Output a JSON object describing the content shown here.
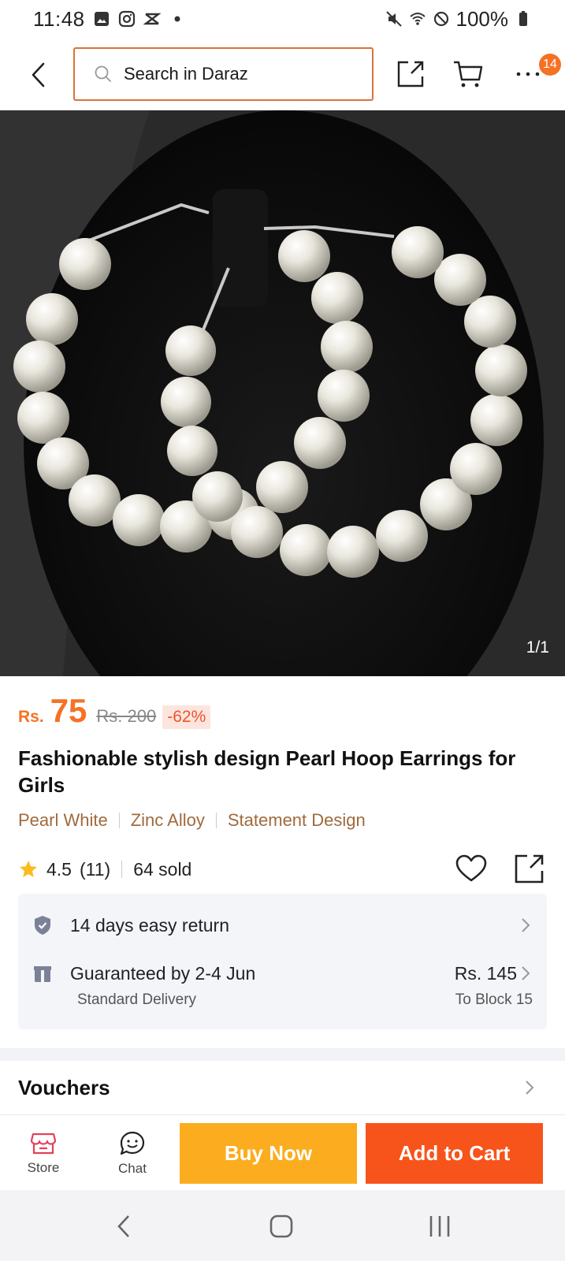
{
  "status_bar": {
    "time": "11:48",
    "battery": "100%"
  },
  "header": {
    "search_placeholder": "Search in Daraz",
    "cart_badge": "14"
  },
  "gallery": {
    "counter": "1/1",
    "background_color": "#0b0b0b"
  },
  "product": {
    "currency": "Rs.",
    "price": "75",
    "original_price": "Rs. 200",
    "discount": "-62%",
    "title": "Fashionable stylish design Pearl Hoop Earrings for Girls",
    "tags": [
      "Pearl White",
      "Zinc Alloy",
      "Statement Design"
    ],
    "rating": "4.5",
    "rating_count": "(11)",
    "sold": "64 sold"
  },
  "services": {
    "return_text": "14 days easy return",
    "delivery_text": "Guaranteed by 2-4 Jun",
    "delivery_type": "Standard Delivery",
    "delivery_price": "Rs. 145",
    "delivery_destination": "To Block 15"
  },
  "vouchers": {
    "title": "Vouchers"
  },
  "action_bar": {
    "store_label": "Store",
    "chat_label": "Chat",
    "buy_now_label": "Buy Now",
    "add_to_cart_label": "Add to Cart"
  },
  "colors": {
    "accent_orange": "#f57224",
    "buy_now": "#fbad1f",
    "add_to_cart": "#f6541a",
    "tag_brown": "#a06a3c"
  }
}
